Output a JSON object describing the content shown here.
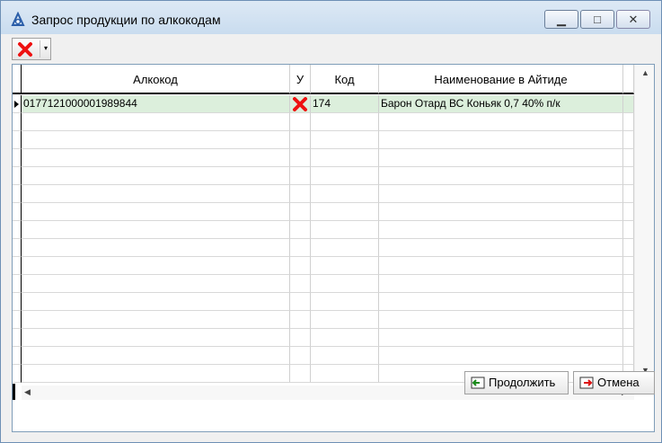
{
  "window": {
    "title": "Запрос продукции по алкокодам",
    "controls": {
      "minimize": "▁",
      "maximize": "□",
      "close": "✕"
    }
  },
  "toolbar": {
    "delete_button": "delete-icon",
    "dropdown_arrow": "▾"
  },
  "table": {
    "columns": [
      "Алкокод",
      "У",
      "Код",
      "Наименование в Айтиде"
    ],
    "rows": [
      {
        "alcocode": "0177121000001989844",
        "status_icon": "red-x-icon",
        "code": "174",
        "name": "Барон Отард ВС Коньяк 0,7 40% п/к"
      }
    ]
  },
  "footer": {
    "continue_label": "Продолжить",
    "cancel_label": "Отмена"
  },
  "colors": {
    "selected_row": "#dcefdc",
    "accent": "#6d8fb5"
  }
}
